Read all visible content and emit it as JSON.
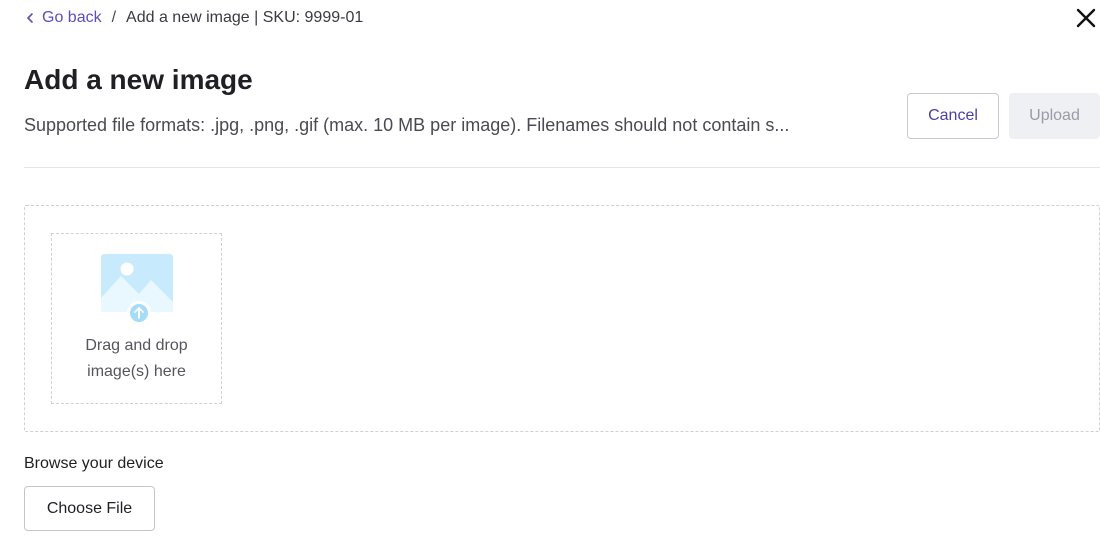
{
  "breadcrumb": {
    "back_label": "Go back",
    "separator": "/",
    "current": "Add a new image | SKU: 9999-01"
  },
  "header": {
    "title": "Add a new image",
    "subtitle": "Supported file formats: .jpg, .png, .gif (max. 10 MB per image). Filenames should not contain s..."
  },
  "actions": {
    "cancel_label": "Cancel",
    "upload_label": "Upload",
    "upload_disabled": true
  },
  "dropzone": {
    "line1": "Drag and drop",
    "line2": "image(s) here"
  },
  "browse": {
    "label": "Browse your device",
    "button_label": "Choose File"
  },
  "icons": {
    "back": "chevron-left-icon",
    "close": "close-icon",
    "illustration": "image-upload-icon"
  },
  "colors": {
    "accent": "#5b4fb8",
    "illustration_light": "#bfe6fb",
    "illustration_dark": "#9fd8f6"
  }
}
